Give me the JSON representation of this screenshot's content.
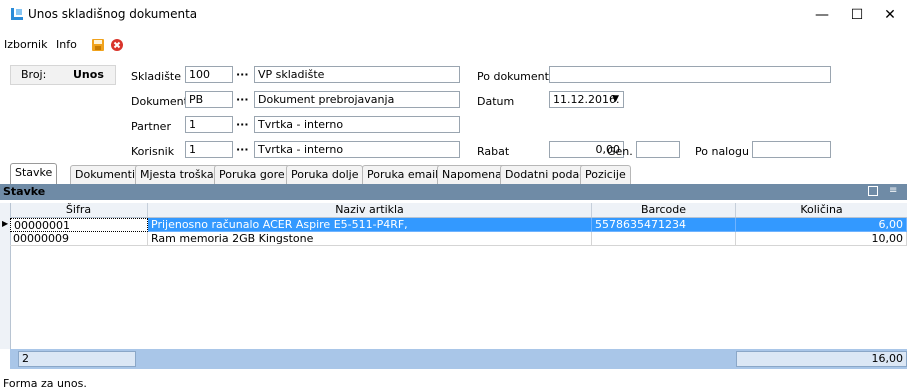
{
  "window": {
    "title": "Unos skladišnog dokumenta",
    "minimize": "—",
    "maximize": "☐",
    "close": "✕"
  },
  "menu": {
    "izbornik": "Izbornik",
    "info": "Info",
    "save_icon": "save-icon",
    "cancel_icon": "cancel-icon"
  },
  "header": {
    "broj_label": "Broj:",
    "broj_value": "Unos",
    "skladiste_label": "Skladište",
    "skladiste_code": "100",
    "skladiste_name": "VP skladište",
    "dokument_label": "Dokument",
    "dokument_code": "PB",
    "dokument_name": "Dokument prebrojavanja",
    "partner_label": "Partner",
    "partner_code": "1",
    "partner_name": "Tvrtka - interno",
    "korisnik_label": "Korisnik",
    "korisnik_code": "1",
    "korisnik_name": "Tvrtka - interno",
    "po_dokumentu_label": "Po dokumentu",
    "po_dokumentu_value": "",
    "datum_label": "Datum",
    "datum_value": "11.12.2016.",
    "rabat_label": "Rabat",
    "rabat_value": "0,00",
    "gen_label": "Gen.",
    "gen_value": "",
    "po_nalogu_label": "Po nalogu",
    "po_nalogu_value": "",
    "lookup_dots": "···"
  },
  "tabs": [
    "Stavke",
    "Dokumenti",
    "Mjesta troška",
    "Poruka gore",
    "Poruka dolje",
    "Poruka email",
    "Napomena",
    "Dodatni podaci",
    "Pozicije"
  ],
  "section": {
    "title": "Stavke"
  },
  "grid": {
    "columns": [
      "Šifra",
      "Naziv artikla",
      "Barcode",
      "Količina"
    ],
    "rows": [
      {
        "sifra": "00000001",
        "naziv": "Prijenosno računalo ACER Aspire E5-511-P4RF,",
        "barcode": "5578635471234",
        "kolicina": "6,00"
      },
      {
        "sifra": "00000009",
        "naziv": "Ram memoria 2GB Kingstone",
        "barcode": "",
        "kolicina": "10,00"
      }
    ],
    "footer_count": "2",
    "footer_total": "16,00"
  },
  "status": "Forma za unos.",
  "colors": {
    "selection": "#3399ff",
    "section_header": "#6f8ba6",
    "footer": "#a9c6e8"
  }
}
